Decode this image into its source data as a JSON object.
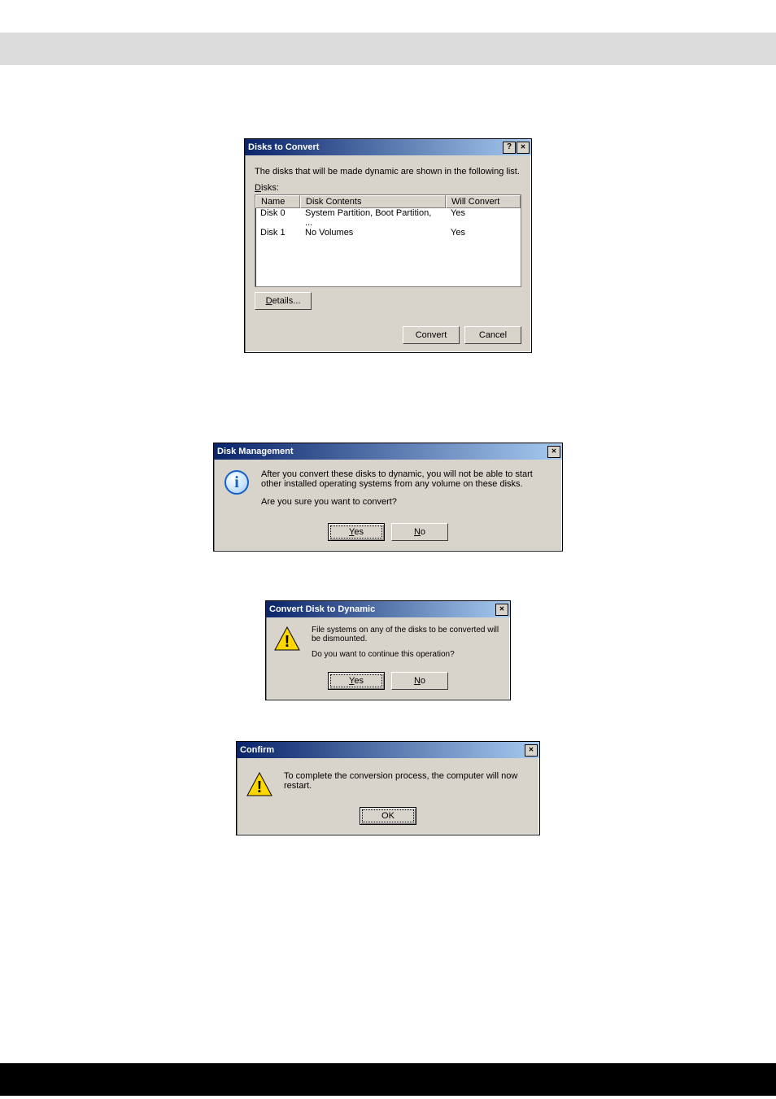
{
  "dialogs": {
    "convert_list": {
      "title": "Disks to Convert",
      "description": "The disks that will be made dynamic are shown in the following list.",
      "list_label_pre": "D",
      "list_label_rest": "isks:",
      "columns": {
        "name": "Name",
        "contents": "Disk Contents",
        "will": "Will Convert"
      },
      "rows": [
        {
          "name": "Disk 0",
          "contents": "System Partition, Boot Partition, ...",
          "will": "Yes"
        },
        {
          "name": "Disk 1",
          "contents": "No Volumes",
          "will": "Yes"
        }
      ],
      "details_btn_pre": "D",
      "details_btn_rest": "etails...",
      "convert_btn": "Convert",
      "cancel_btn": "Cancel"
    },
    "confirm1": {
      "title": "Disk Management",
      "line1": "After you convert these disks to dynamic, you will not be able to start other installed operating systems from any volume on these disks.",
      "line2": "Are you sure you want to convert?",
      "yes_pre": "Y",
      "yes_rest": "es",
      "no_pre": "N",
      "no_rest": "o"
    },
    "confirm2": {
      "title": "Convert Disk to Dynamic",
      "line1": "File systems on any of the disks to be converted will be  dismounted.",
      "line2": "Do you want to continue this operation?",
      "yes_pre": "Y",
      "yes_rest": "es",
      "no_pre": "N",
      "no_rest": "o"
    },
    "confirm3": {
      "title": "Confirm",
      "line1": "To complete the conversion process, the computer will now restart.",
      "ok": "OK"
    }
  }
}
